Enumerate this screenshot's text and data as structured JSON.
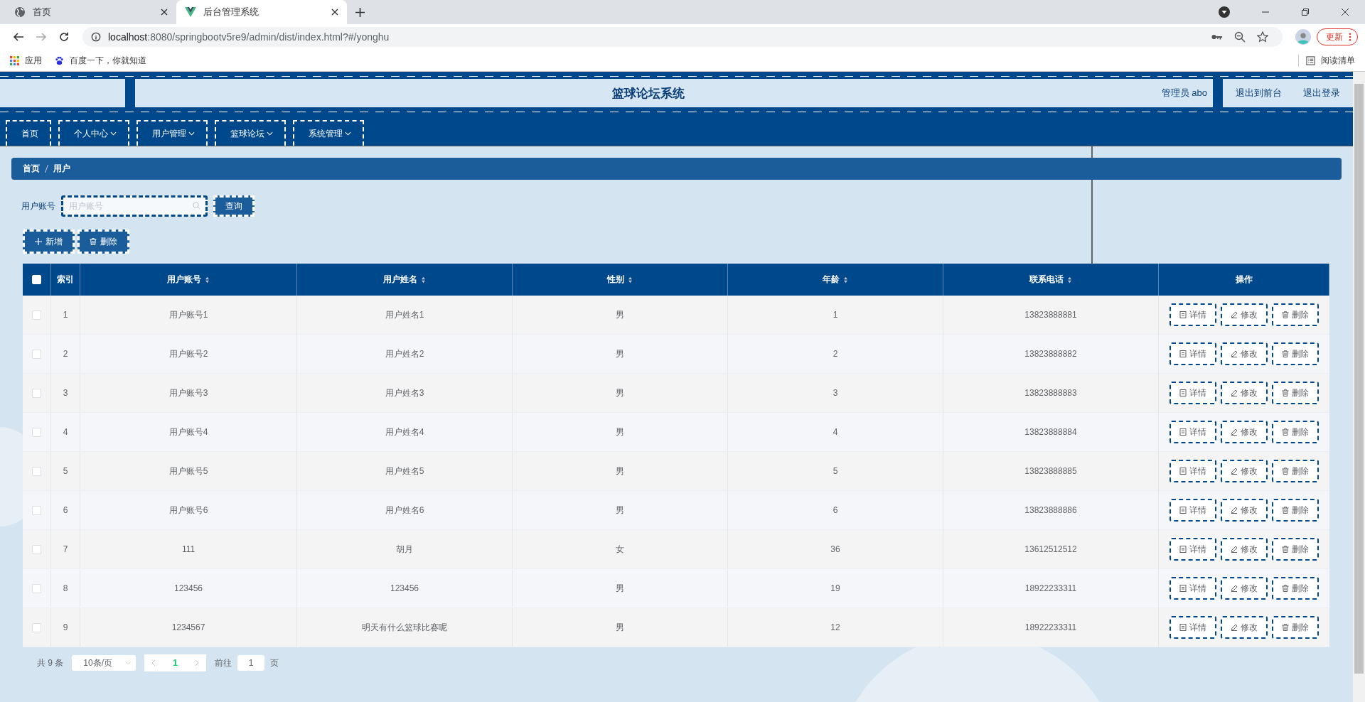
{
  "browser": {
    "tabs": [
      {
        "title": "首页",
        "selected": false
      },
      {
        "title": "后台管理系统",
        "selected": true
      }
    ],
    "url_host": "localhost",
    "url_rest": ":8080/springbootv5re9/admin/dist/index.html?#/yonghu",
    "update_button": "更新",
    "bookmarks": [
      "应用",
      "百度一下，你就知道"
    ],
    "reading_list": "阅读清单"
  },
  "header": {
    "title": "篮球论坛系统",
    "user_label": "管理员 abo",
    "links": [
      "退出到前台",
      "退出登录"
    ]
  },
  "nav": {
    "items": [
      {
        "label": "首页",
        "has_menu": false
      },
      {
        "label": "个人中心",
        "has_menu": true
      },
      {
        "label": "用户管理",
        "has_menu": true
      },
      {
        "label": "篮球论坛",
        "has_menu": true
      },
      {
        "label": "系统管理",
        "has_menu": true
      }
    ]
  },
  "breadcrumb": [
    "首页",
    "用户"
  ],
  "search": {
    "label": "用户账号",
    "placeholder": "用户账号",
    "button": "查询"
  },
  "actions": [
    {
      "label": "新增",
      "kind": "add"
    },
    {
      "label": "删除",
      "kind": "delete"
    }
  ],
  "table": {
    "select_all_checked": false,
    "columns": [
      {
        "label": "索引",
        "sortable": false
      },
      {
        "label": "用户账号",
        "sortable": true
      },
      {
        "label": "用户姓名",
        "sortable": true
      },
      {
        "label": "性别",
        "sortable": true
      },
      {
        "label": "年龄",
        "sortable": true
      },
      {
        "label": "联系电话",
        "sortable": true
      },
      {
        "label": "操作",
        "sortable": false
      }
    ],
    "rows": [
      {
        "checked": false,
        "index": "1",
        "account": "用户账号1",
        "name": "用户姓名1",
        "gender": "男",
        "age": "1",
        "phone": "13823888881",
        "actions": [
          "详情",
          "修改",
          "删除"
        ]
      },
      {
        "checked": false,
        "index": "2",
        "account": "用户账号2",
        "name": "用户姓名2",
        "gender": "男",
        "age": "2",
        "phone": "13823888882",
        "actions": [
          "详情",
          "修改",
          "删除"
        ]
      },
      {
        "checked": false,
        "index": "3",
        "account": "用户账号3",
        "name": "用户姓名3",
        "gender": "男",
        "age": "3",
        "phone": "13823888883",
        "actions": [
          "详情",
          "修改",
          "删除"
        ]
      },
      {
        "checked": false,
        "index": "4",
        "account": "用户账号4",
        "name": "用户姓名4",
        "gender": "男",
        "age": "4",
        "phone": "13823888884",
        "actions": [
          "详情",
          "修改",
          "删除"
        ]
      },
      {
        "checked": false,
        "index": "5",
        "account": "用户账号5",
        "name": "用户姓名5",
        "gender": "男",
        "age": "5",
        "phone": "13823888885",
        "actions": [
          "详情",
          "修改",
          "删除"
        ]
      },
      {
        "checked": false,
        "index": "6",
        "account": "用户账号6",
        "name": "用户姓名6",
        "gender": "男",
        "age": "6",
        "phone": "13823888886",
        "actions": [
          "详情",
          "修改",
          "删除"
        ]
      },
      {
        "checked": false,
        "index": "7",
        "account": "111",
        "name": "胡月",
        "gender": "女",
        "age": "36",
        "phone": "13612512512",
        "actions": [
          "详情",
          "修改",
          "删除"
        ]
      },
      {
        "checked": false,
        "index": "8",
        "account": "123456",
        "name": "123456",
        "gender": "男",
        "age": "19",
        "phone": "18922233311",
        "actions": [
          "详情",
          "修改",
          "删除"
        ]
      },
      {
        "checked": false,
        "index": "9",
        "account": "1234567",
        "name": "明天有什么篮球比赛呢",
        "gender": "男",
        "age": "12",
        "phone": "18922233311",
        "actions": [
          "详情",
          "修改",
          "删除"
        ]
      }
    ]
  },
  "pagination": {
    "total": "共 9 条",
    "page_size": "10条/页",
    "pages": [
      {
        "label": "1",
        "selected": true
      }
    ],
    "goto_label": "前往",
    "goto_value": "1",
    "goto_suffix": "页"
  }
}
